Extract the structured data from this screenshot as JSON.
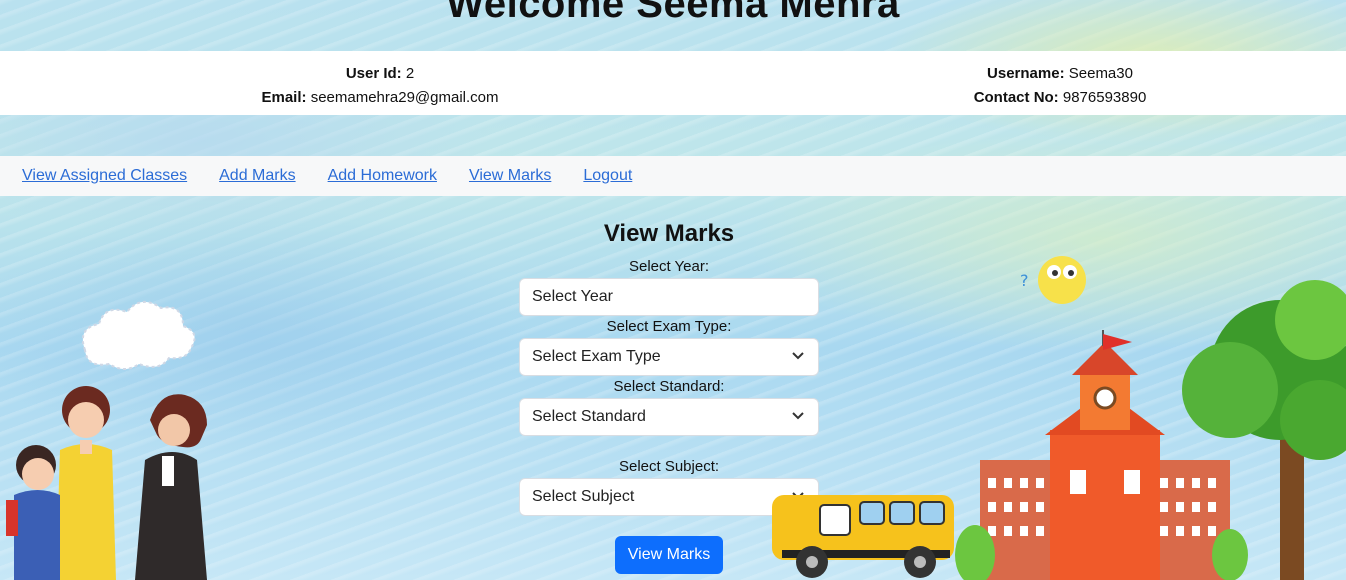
{
  "header": {
    "welcome": "Welcome Seema Mehra"
  },
  "user_info": {
    "user_id_label": "User Id:",
    "user_id": "2",
    "email_label": "Email:",
    "email": "seemamehra29@gmail.com",
    "username_label": "Username:",
    "username": "Seema30",
    "contact_label": "Contact No:",
    "contact": "9876593890"
  },
  "nav": {
    "items": [
      {
        "label": "View Assigned Classes"
      },
      {
        "label": "Add Marks"
      },
      {
        "label": "Add Homework"
      },
      {
        "label": "View Marks"
      },
      {
        "label": "Logout"
      }
    ]
  },
  "form": {
    "title": "View Marks",
    "year_label": "Select Year:",
    "year_placeholder": "Select Year",
    "exam_label": "Select Exam Type:",
    "exam_value": "Select Exam Type",
    "standard_label": "Select Standard:",
    "standard_value": "Select Standard",
    "subject_label": "Select Subject:",
    "subject_value": "Select Subject",
    "submit_label": "View Marks"
  },
  "colors": {
    "link": "#2b6cd6",
    "primary_button": "#0d6efd",
    "school_orange": "#f05a2a"
  }
}
